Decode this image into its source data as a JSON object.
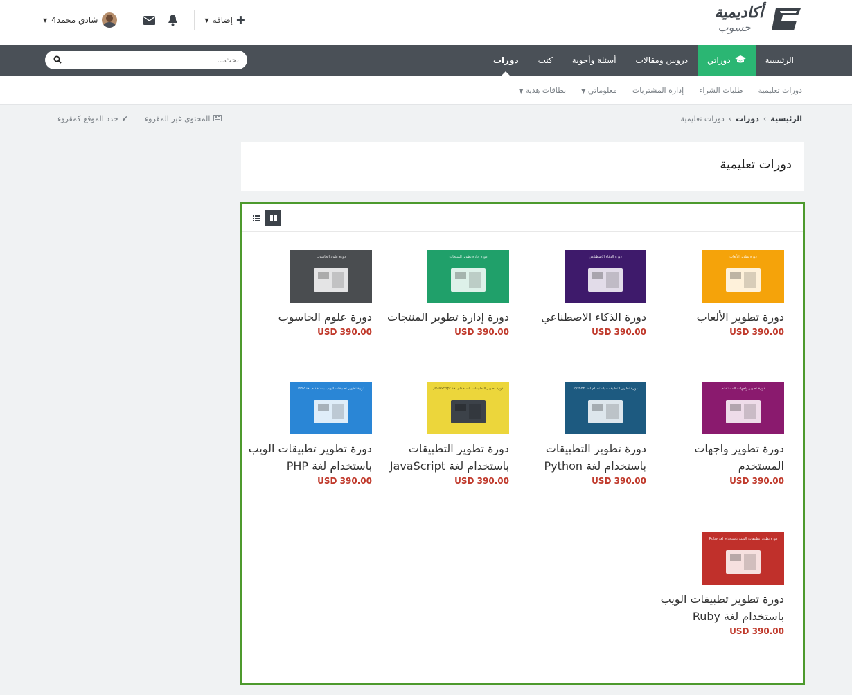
{
  "header": {
    "logo": {
      "line1": "أكاديمية",
      "line2": "حسوب"
    },
    "user_name": "شادي محمد4",
    "add_label": "إضافة"
  },
  "nav": {
    "items": [
      {
        "label": "الرئيسية",
        "icon": ""
      },
      {
        "label": "دوراتي",
        "icon": "graduation-cap-icon",
        "active": true
      },
      {
        "label": "دروس ومقالات"
      },
      {
        "label": "أسئلة وأجوبة"
      },
      {
        "label": "كتب"
      },
      {
        "label": "دورات",
        "current": true
      }
    ],
    "search_placeholder": "بحث..."
  },
  "subnav": {
    "items": [
      {
        "label": "دورات تعليمية"
      },
      {
        "label": "طلبات الشراء"
      },
      {
        "label": "إدارة المشتريات"
      },
      {
        "label": "معلوماتي",
        "dropdown": true
      },
      {
        "label": "بطاقات هدية",
        "dropdown": true
      }
    ]
  },
  "breadcrumb": {
    "home": "الرئيسية",
    "section": "دورات",
    "page": "دورات تعليمية"
  },
  "read_tools": {
    "mark_read": "حدد الموقع كمقروء",
    "unread": "المحتوى غير المقروء"
  },
  "page_title": "دورات تعليمية",
  "courses": [
    {
      "title": "دورة تطوير الألعاب",
      "price": "USD 390.00",
      "color": "#f5a30a",
      "thumb_caption": "دورة تطوير الألعاب"
    },
    {
      "title": "دورة الذكاء الاصطناعي",
      "price": "USD 390.00",
      "color": "#3e1a6b",
      "thumb_caption": "دورة الذكاء الاصطناعي"
    },
    {
      "title": "دورة إدارة تطوير المنتجات",
      "price": "USD 390.00",
      "color": "#20a06a",
      "thumb_caption": "دورة إدارة تطوير المنتجات"
    },
    {
      "title": "دورة علوم الحاسوب",
      "price": "USD 390.00",
      "color": "#4a4d50",
      "thumb_caption": "دورة علوم الحاسوب"
    },
    {
      "title": "دورة تطوير واجهات المستخدم",
      "price": "USD 390.00",
      "color": "#8a1a6e",
      "thumb_caption": "دورة تطوير واجهات المستخدم"
    },
    {
      "title": "دورة تطوير التطبيقات باستخدام لغة Python",
      "price": "USD 390.00",
      "color": "#1d5a80",
      "thumb_caption": "دورة تطوير التطبيقات باستخدام لغة Python"
    },
    {
      "title": "دورة تطوير التطبيقات باستخدام لغة JavaScript",
      "price": "USD 390.00",
      "color": "#ecd63b",
      "thumb_caption": "دورة تطوير التطبيقات باستخدام لغة JavaScript"
    },
    {
      "title": "دورة تطوير تطبيقات الويب باستخدام لغة PHP",
      "price": "USD 390.00",
      "color": "#2a86d6",
      "thumb_caption": "دورة تطوير تطبيقات الويب باستخدام لغة PHP"
    },
    {
      "title": "دورة تطوير تطبيقات الويب باستخدام لغة Ruby",
      "price": "USD 390.00",
      "color": "#c0302b",
      "thumb_caption": "دورة تطوير تطبيقات الويب باستخدام لغة Ruby"
    }
  ]
}
